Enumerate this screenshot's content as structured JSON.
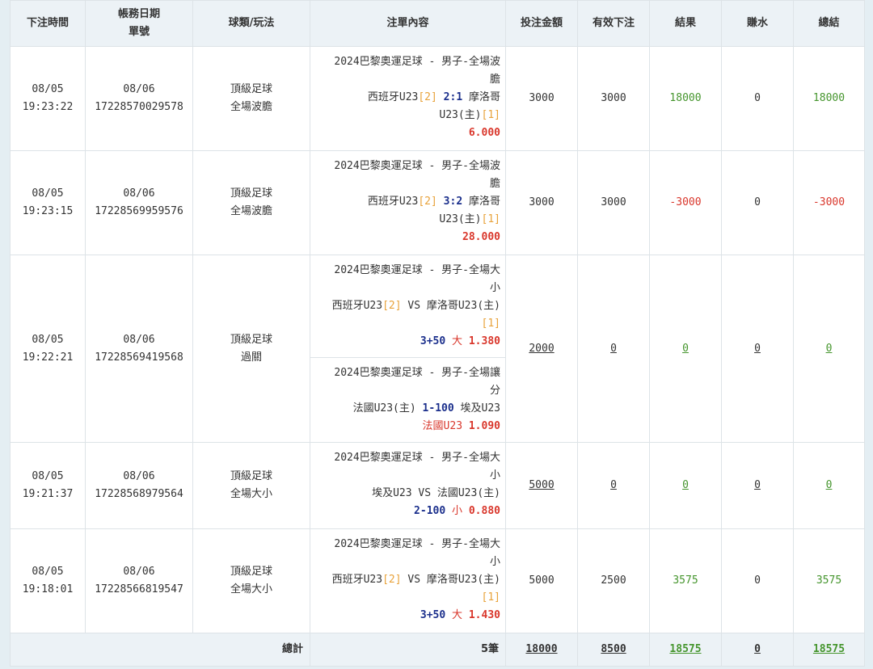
{
  "headers": {
    "time": "下注時間",
    "date": [
      "帳務日期",
      "單號"
    ],
    "sport": "球類/玩法",
    "content": "注單內容",
    "stake": "投注金額",
    "valid": "有效下注",
    "result": "結果",
    "rebate": "賺水",
    "total": "總結"
  },
  "rows": [
    {
      "time": [
        "08/05",
        "19:23:22"
      ],
      "date": [
        "08/06",
        "17228570029578"
      ],
      "sport": [
        "頂級足球",
        "全場波膽"
      ],
      "details": [
        {
          "league": "2024巴黎奧運足球 - 男子-全場波",
          "league2": "膽",
          "home": "西班牙U23",
          "home_rank": "[2]",
          "pick": "2:1",
          "away": "摩洛哥",
          "away2": "U23(主)",
          "away_rank": "[1]",
          "odds": "6.000"
        }
      ],
      "stake": "3000",
      "valid": "3000",
      "result": "18000",
      "rebate": "0",
      "total": "18000"
    },
    {
      "time": [
        "08/05",
        "19:23:15"
      ],
      "date": [
        "08/06",
        "17228569959576"
      ],
      "sport": [
        "頂級足球",
        "全場波膽"
      ],
      "details": [
        {
          "league": "2024巴黎奧運足球 - 男子-全場波",
          "league2": "膽",
          "home": "西班牙U23",
          "home_rank": "[2]",
          "pick": "3:2",
          "away": "摩洛哥",
          "away2": "U23(主)",
          "away_rank": "[1]",
          "odds": "28.000"
        }
      ],
      "stake": "3000",
      "valid": "3000",
      "result": "-3000",
      "rebate": "0",
      "total": "-3000"
    },
    {
      "time": [
        "08/05",
        "19:22:21"
      ],
      "date": [
        "08/06",
        "17228569419568"
      ],
      "sport": [
        "頂級足球",
        "過關"
      ],
      "details": [
        {
          "league": "2024巴黎奧運足球 - 男子-全場大",
          "league2": "小",
          "home": "西班牙U23",
          "home_rank": "[2]",
          "vs": "VS",
          "away": "摩洛哥U23(主)",
          "away_rank": "[1]",
          "line": "3+50",
          "side": "大",
          "odds": "1.380"
        },
        {
          "league": "2024巴黎奧運足球 - 男子-全場讓",
          "league2": "分",
          "home": "法國U23(主)",
          "line": "1-100",
          "away": "埃及U23",
          "side": "法國U23",
          "odds": "1.090"
        }
      ],
      "stake": "2000",
      "valid": "0",
      "result": "0",
      "rebate": "0",
      "total": "0"
    },
    {
      "time": [
        "08/05",
        "19:21:37"
      ],
      "date": [
        "08/06",
        "17228568979564"
      ],
      "sport": [
        "頂級足球",
        "全場大小"
      ],
      "details": [
        {
          "league": "2024巴黎奧運足球 - 男子-全場大",
          "league2": "小",
          "home": "埃及U23",
          "vs": "VS",
          "away": "法國U23(主)",
          "line": "2-100",
          "side": "小",
          "odds": "0.880"
        }
      ],
      "stake": "5000",
      "valid": "0",
      "result": "0",
      "rebate": "0",
      "total": "0"
    },
    {
      "time": [
        "08/05",
        "19:18:01"
      ],
      "date": [
        "08/06",
        "17228566819547"
      ],
      "sport": [
        "頂級足球",
        "全場大小"
      ],
      "details": [
        {
          "league": "2024巴黎奧運足球 - 男子-全場大",
          "league2": "小",
          "home": "西班牙U23",
          "home_rank": "[2]",
          "vs": "VS",
          "away": "摩洛哥U23(主)",
          "away_rank": "[1]",
          "line": "3+50",
          "side": "大",
          "odds": "1.430"
        }
      ],
      "stake": "5000",
      "valid": "2500",
      "result": "3575",
      "rebate": "0",
      "total": "3575"
    }
  ],
  "footer": {
    "label": "總計",
    "count": "5筆",
    "stake": "18000",
    "valid": "8500",
    "result": "18575",
    "rebate": "0",
    "total": "18575"
  },
  "colors": {
    "positive": "#45952d",
    "negative": "#d9372c",
    "pick": "#1b2f8c",
    "rank": "#e8a23a",
    "header_bg": "#ecf2f6",
    "page_bg": "#e4eef3"
  }
}
